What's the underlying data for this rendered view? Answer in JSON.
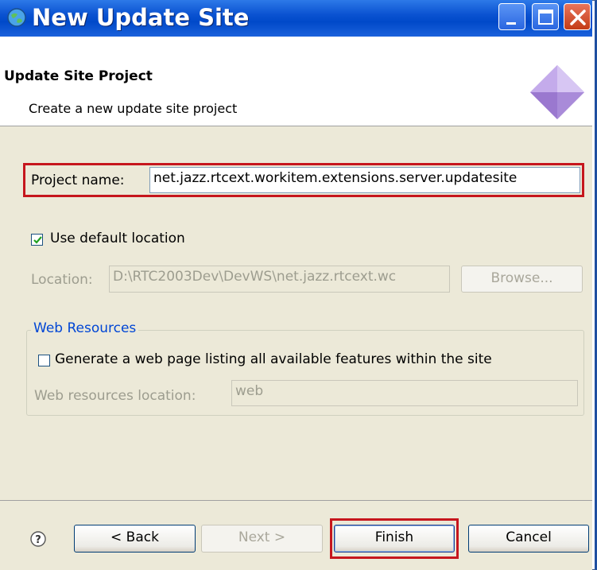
{
  "window": {
    "title": "New Update Site"
  },
  "header": {
    "title": "Update Site Project",
    "description": "Create a new update site project"
  },
  "form": {
    "project_name_label": "Project name:",
    "project_name_value": "net.jazz.rtcext.workitem.extensions.server.updatesite",
    "use_default_location_label": "Use default location",
    "use_default_location_checked": true,
    "location_label": "Location:",
    "location_value": "D:\\RTC2003Dev\\DevWS\\net.jazz.rtcext.wc",
    "browse_label": "Browse...",
    "web_resources_legend": "Web Resources",
    "generate_web_page_label": "Generate a web page listing all available features within the site",
    "generate_web_page_checked": false,
    "web_resources_location_label": "Web resources location:",
    "web_resources_location_value": "web"
  },
  "footer": {
    "help_icon": "help-icon",
    "back_label": "< Back",
    "next_label": "Next >",
    "finish_label": "Finish",
    "cancel_label": "Cancel"
  },
  "colors": {
    "highlight": "#c6161d",
    "titlebar": "#0a52d1",
    "dialog_bg": "#ece9d8",
    "link_blue": "#0046d5"
  }
}
